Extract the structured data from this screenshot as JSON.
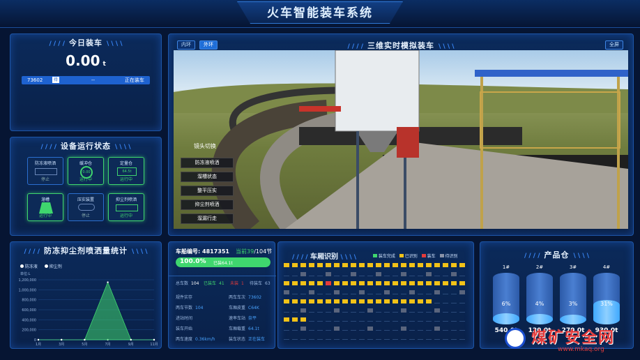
{
  "header": {
    "title": "火车智能装车系统"
  },
  "today": {
    "title": "今日装车",
    "value": "0.00",
    "unit": "t",
    "row": {
      "id": "73602",
      "tag": "待",
      "middle": "--",
      "status": "正在装车"
    }
  },
  "devices": {
    "title": "设备运行状态",
    "items": [
      {
        "name": "防冻液喷洒",
        "status": "停止",
        "on": false
      },
      {
        "name": "缓冲仓",
        "value": "0.00",
        "status": "运行中",
        "on": true
      },
      {
        "name": "定量仓",
        "value": "64.5t",
        "status": "运行中",
        "on": true
      },
      {
        "name": "溜槽",
        "status": "运行中",
        "on": true
      },
      {
        "name": "压实装置",
        "status": "停止",
        "on": false
      },
      {
        "name": "抑尘剂喷洒",
        "status": "运行中",
        "on": true
      }
    ]
  },
  "spray": {
    "title": "防冻抑尘剂喷洒量统计",
    "legend": [
      "防冻液",
      "抑尘剂"
    ],
    "unit": "单位:L",
    "chart_data": {
      "type": "area",
      "categories": [
        "1月",
        "3月",
        "5月",
        "7月",
        "9月",
        "11月"
      ],
      "series": [
        {
          "name": "防冻液",
          "values": [
            0,
            0,
            0,
            0,
            0,
            0
          ]
        },
        {
          "name": "抑尘剂",
          "values": [
            0,
            0,
            0,
            1150000,
            0,
            0
          ]
        }
      ],
      "yticks": [
        "1,200,000",
        "1,000,000",
        "800,000",
        "600,000",
        "400,000",
        "200,000",
        "0"
      ],
      "ylim": [
        0,
        1200000
      ]
    }
  },
  "tabs": {
    "inner": "内环",
    "outer": "外环",
    "full": "全屏"
  },
  "scene": {
    "title": "三维实时模拟装车",
    "menu_title": "镜头切换",
    "menu": [
      "防冻液喷洒",
      "溜槽状态",
      "整平压实",
      "抑尘剂喷洒",
      "溜漏行走"
    ]
  },
  "train": {
    "number_label": "车船编号:",
    "number": "4817351",
    "current": "当前39",
    "total": "/104节",
    "progress_pct": 1.0,
    "progress_text": "100.0%",
    "progress_sub": "已装64.1t",
    "counts": [
      {
        "k": "总车数",
        "v": "104"
      },
      {
        "k": "已装车",
        "v": "41"
      },
      {
        "k": "未装",
        "v": "1"
      },
      {
        "k": "待装车",
        "v": "63"
      }
    ],
    "details": [
      {
        "k": "规件实存",
        "v": ""
      },
      {
        "k": "两车车次",
        "v": "73602"
      },
      {
        "k": "两车节数",
        "v": "104"
      },
      {
        "k": "车厢皮重",
        "v": "C64K"
      },
      {
        "k": "进站时间",
        "v": ""
      },
      {
        "k": "速率车站",
        "v": "奈平"
      },
      {
        "k": "装车开始",
        "v": ""
      },
      {
        "k": "车厢载重",
        "v": "64.1t"
      },
      {
        "k": "两车速度",
        "v": "0.36km/h"
      },
      {
        "k": "装车状态",
        "v": "正在装车"
      }
    ]
  },
  "wagons": {
    "title": "车厢识别",
    "legend": [
      {
        "name": "装车完成",
        "color": "#3fd66e"
      },
      {
        "name": "已识别",
        "color": "#f2c218"
      },
      {
        "name": "装车",
        "color": "#e33b3b"
      },
      {
        "name": "待识别",
        "color": "#8a93a8"
      }
    ]
  },
  "product": {
    "title": "产品仓",
    "bins": [
      {
        "label": "1#",
        "pct": 0.06,
        "pct_text": "6%",
        "weight": "540.0t"
      },
      {
        "label": "2#",
        "pct": 0.04,
        "pct_text": "4%",
        "weight": "120.0t"
      },
      {
        "label": "3#",
        "pct": 0.03,
        "pct_text": "3%",
        "weight": "270.0t"
      },
      {
        "label": "4#",
        "pct": 0.31,
        "pct_text": "31%",
        "weight": "930.0t"
      }
    ]
  },
  "watermark": {
    "text": "煤矿安全网",
    "url": "www.mkaq.org"
  }
}
